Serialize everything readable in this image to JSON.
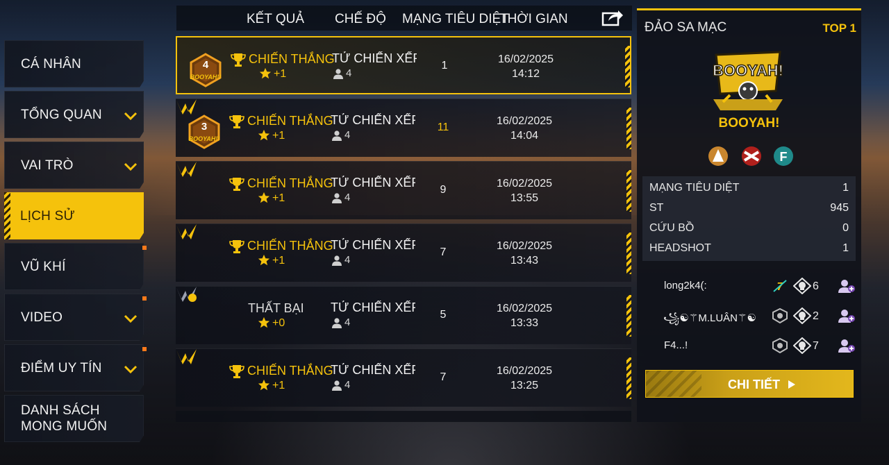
{
  "sidebar": {
    "items": [
      {
        "label": "CÁ NHÂN",
        "chevron": false
      },
      {
        "label": "TỔNG QUAN",
        "chevron": true
      },
      {
        "label": "VAI TRÒ",
        "chevron": true
      },
      {
        "label": "LỊCH SỬ",
        "chevron": false,
        "active": true
      },
      {
        "label": "VŨ KHÍ",
        "chevron": false
      },
      {
        "label": "VIDEO",
        "chevron": true
      },
      {
        "label": "ĐIỂM UY TÍN",
        "chevron": true
      },
      {
        "label": "DANH SÁCH\nMONG MUỐN",
        "chevron": false
      }
    ]
  },
  "header": {
    "result": "KẾT QUẢ",
    "mode": "CHẾ ĐỘ",
    "kills": "MẠNG TIÊU DIỆT",
    "time": "THỜI GIAN",
    "share_icon": "share-icon"
  },
  "matches": [
    {
      "result": "CHIẾN THẮNG",
      "points": "+1",
      "mode": "TỬ CHIẾN XẾP HẠNG",
      "team": "4",
      "kills": "1",
      "date": "16/02/2025",
      "time": "14:12",
      "rank": "4",
      "rank_label": "BOOYAH!!"
    },
    {
      "result": "CHIẾN THẮNG",
      "points": "+1",
      "mode": "TỬ CHIẾN XẾP HẠNG",
      "team": "4",
      "kills": "11",
      "date": "16/02/2025",
      "time": "14:04",
      "rank": "3",
      "rank_label": "BOOYAH!!"
    },
    {
      "result": "CHIẾN THẮNG",
      "points": "+1",
      "mode": "TỬ CHIẾN XẾP HẠNG",
      "team": "4",
      "kills": "9",
      "date": "16/02/2025",
      "time": "13:55"
    },
    {
      "result": "CHIẾN THẮNG",
      "points": "+1",
      "mode": "TỬ CHIẾN XẾP HẠNG",
      "team": "4",
      "kills": "7",
      "date": "16/02/2025",
      "time": "13:43"
    },
    {
      "result": "THẤT BẠI",
      "points": "+0",
      "mode": "TỬ CHIẾN XẾP HẠNG",
      "team": "4",
      "kills": "5",
      "date": "16/02/2025",
      "time": "13:33"
    },
    {
      "result": "CHIẾN THẮNG",
      "points": "+1",
      "mode": "TỬ CHIẾN XẾP HẠNG",
      "team": "4",
      "kills": "7",
      "date": "16/02/2025",
      "time": "13:25"
    }
  ],
  "detail": {
    "map": "ĐẢO SA MẠC",
    "top": "TOP 1",
    "booyah_art_text": "BOOYAH!",
    "booyah_label": "BOOYAH!",
    "stats": [
      {
        "label": "MẠNG TIÊU DIỆT",
        "value": "1"
      },
      {
        "label": "ST",
        "value": "945"
      },
      {
        "label": "CỨU BỒ",
        "value": "0"
      },
      {
        "label": "HEADSHOT",
        "value": "1"
      }
    ],
    "players": [
      {
        "name": "long2k4(:",
        "kills": "6"
      },
      {
        "name": "꧁☯︎⚚M.LUÂN⚚☯︎",
        "kills": "2"
      },
      {
        "name": "F4...!",
        "kills": "7"
      }
    ],
    "detail_button": "CHI TIẾT"
  },
  "colors": {
    "accent": "#f5c20c",
    "panel": "#10121a",
    "notify_dot": "#ff7a1a"
  }
}
